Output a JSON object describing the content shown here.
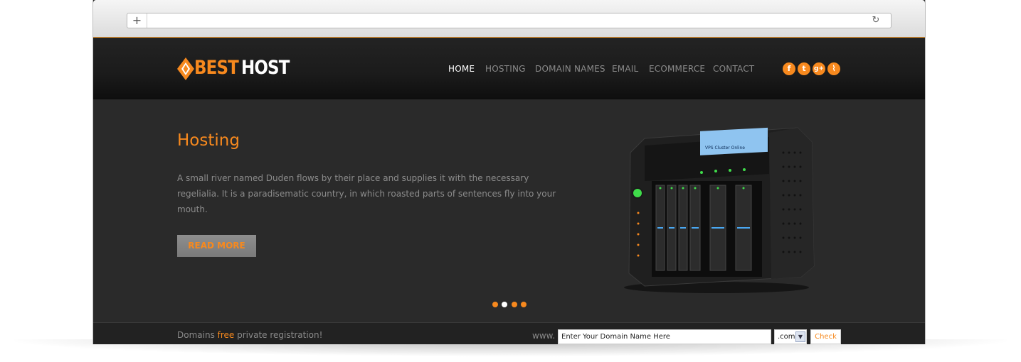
{
  "brand": {
    "name_part1": "BEST",
    "name_part2": "HOST",
    "accent_color": "#f7891e"
  },
  "browser": {
    "new_tab_symbol": "+",
    "reload_symbol": "↻"
  },
  "nav": {
    "items": [
      {
        "label": "HOME",
        "active": true
      },
      {
        "label": "HOSTING"
      },
      {
        "label": "DOMAIN NAMES"
      },
      {
        "label": "EMAIL"
      },
      {
        "label": "ECOMMERCE"
      },
      {
        "label": "CONTACT"
      }
    ]
  },
  "social": {
    "icons": [
      "facebook-icon",
      "twitter-icon",
      "google-plus-icon",
      "rss-icon"
    ],
    "glyphs": [
      "f",
      "t",
      "g+",
      "⌇"
    ]
  },
  "hero": {
    "title": "Hosting",
    "text": "A small river named Duden flows by their place and supplies it with the necessary regelialia. It is a paradisematic country, in which roasted parts of sentences fly into your mouth.",
    "button_label": "READ MORE",
    "server_screen_title": "VPS Cluster Online",
    "slider_dots": 4,
    "slider_current": 2
  },
  "domain": {
    "text_before": "Domains ",
    "text_highlight": "free",
    "text_after": " private registration!",
    "www_label": "www.",
    "input_value": "Enter Your Domain Name Here",
    "tld_value": ".com",
    "check_label": "Check"
  }
}
